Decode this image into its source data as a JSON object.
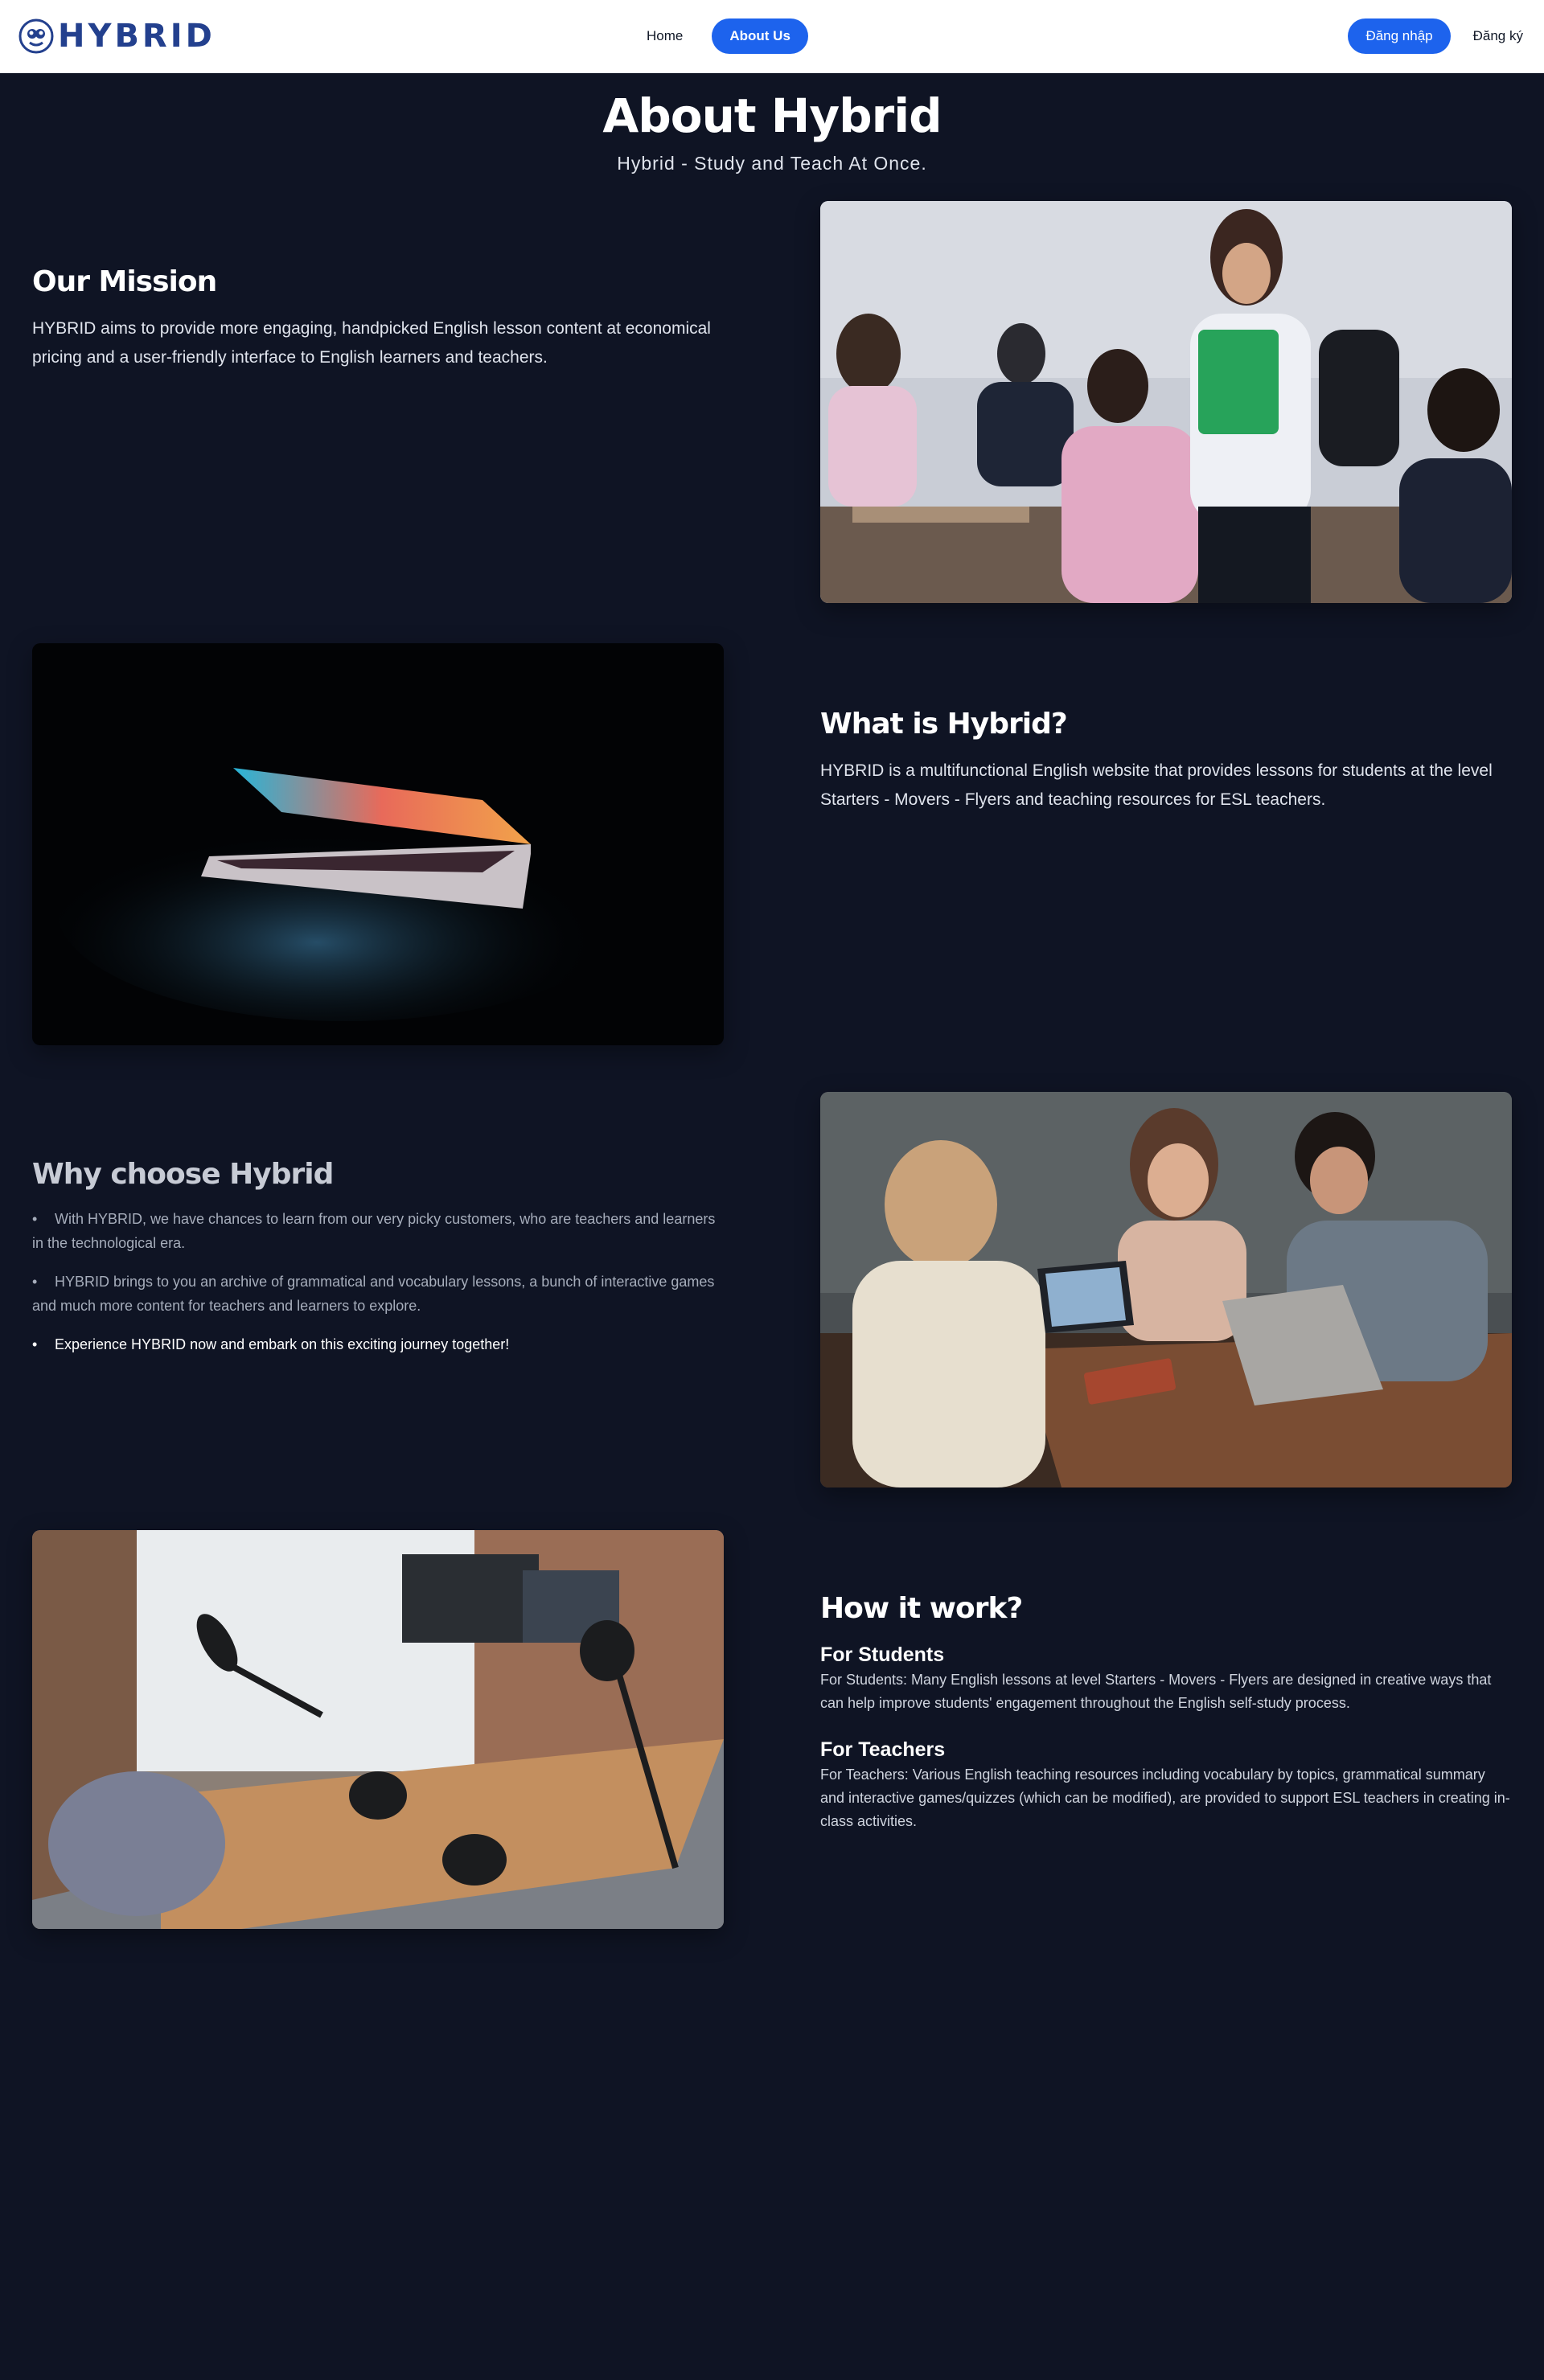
{
  "nav": {
    "logo_text": "HYBRID",
    "home": "Home",
    "about": "About Us",
    "login": "Đăng nhập",
    "register": "Đăng ký"
  },
  "hero": {
    "title": "About Hybrid",
    "subtitle": "Hybrid - Study and Teach At Once."
  },
  "mission": {
    "title": "Our Mission",
    "text": "HYBRID aims to provide more engaging, handpicked English lesson content at economical pricing and a user-friendly interface to English learners and teachers."
  },
  "what": {
    "title": "What is Hybrid?",
    "text": "HYBRID is a multifunctional English website that provides lessons for students at the level Starters - Movers - Flyers and teaching resources for ESL teachers."
  },
  "why": {
    "title": "Why choose Hybrid",
    "items": [
      "With HYBRID, we have chances to learn from our very picky customers, who are teachers and learners in the technological era.",
      "HYBRID brings to you an archive of grammatical and vocabulary lessons, a bunch of interactive games and much more content for teachers and learners to explore.",
      "Experience HYBRID now and embark on this exciting journey together!"
    ]
  },
  "how": {
    "title": "How it work?",
    "students_title": "For Students",
    "students_text": "For Students: Many English lessons at level Starters - Movers - Flyers are designed in creative ways that can help improve students' engagement throughout the English self-study process.",
    "teachers_title": "For Teachers",
    "teachers_text": "For Teachers: Various English teaching resources including vocabulary by topics, grammatical summary and interactive games/quizzes (which can be modified), are provided to support ESL teachers in creating in-class activities."
  },
  "colors": {
    "background": "#0f1424",
    "accent": "#1d63ed",
    "logo": "#23408e"
  }
}
